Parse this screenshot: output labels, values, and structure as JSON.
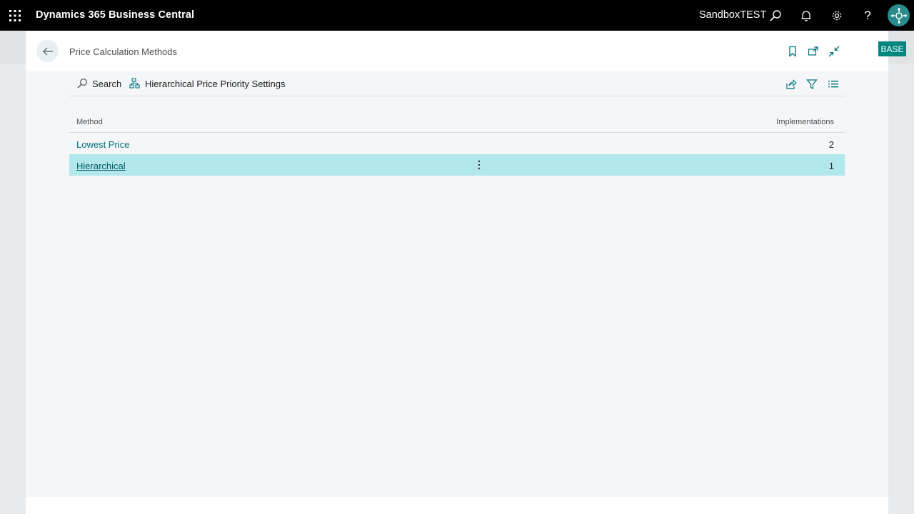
{
  "appbar": {
    "title": "Dynamics 365 Business Central",
    "environment": "SandboxTEST",
    "icons": [
      "waffle-icon",
      "search-icon",
      "bell-icon",
      "gear-icon",
      "help-icon",
      "avatar"
    ]
  },
  "page": {
    "title": "Price Calculation Methods",
    "header_icons": [
      "bookmark-icon",
      "open-new-window-icon",
      "collapse-icon"
    ]
  },
  "actions": {
    "search_label": "Search",
    "priority_label": "Hierarchical Price Priority Settings",
    "right_icons": [
      "share-icon",
      "filter-icon",
      "list-view-icon"
    ]
  },
  "list": {
    "columns": {
      "method": "Method",
      "implementations": "Implementations"
    },
    "rows": [
      {
        "method": "Lowest Price",
        "implementations": "2",
        "selected": false
      },
      {
        "method": "Hierarchical",
        "implementations": "1",
        "selected": true
      }
    ]
  },
  "badge": {
    "label": "BASE"
  },
  "colors": {
    "accent": "#00717c",
    "selected_row": "#b2e7ec",
    "badge": "#00857f"
  }
}
